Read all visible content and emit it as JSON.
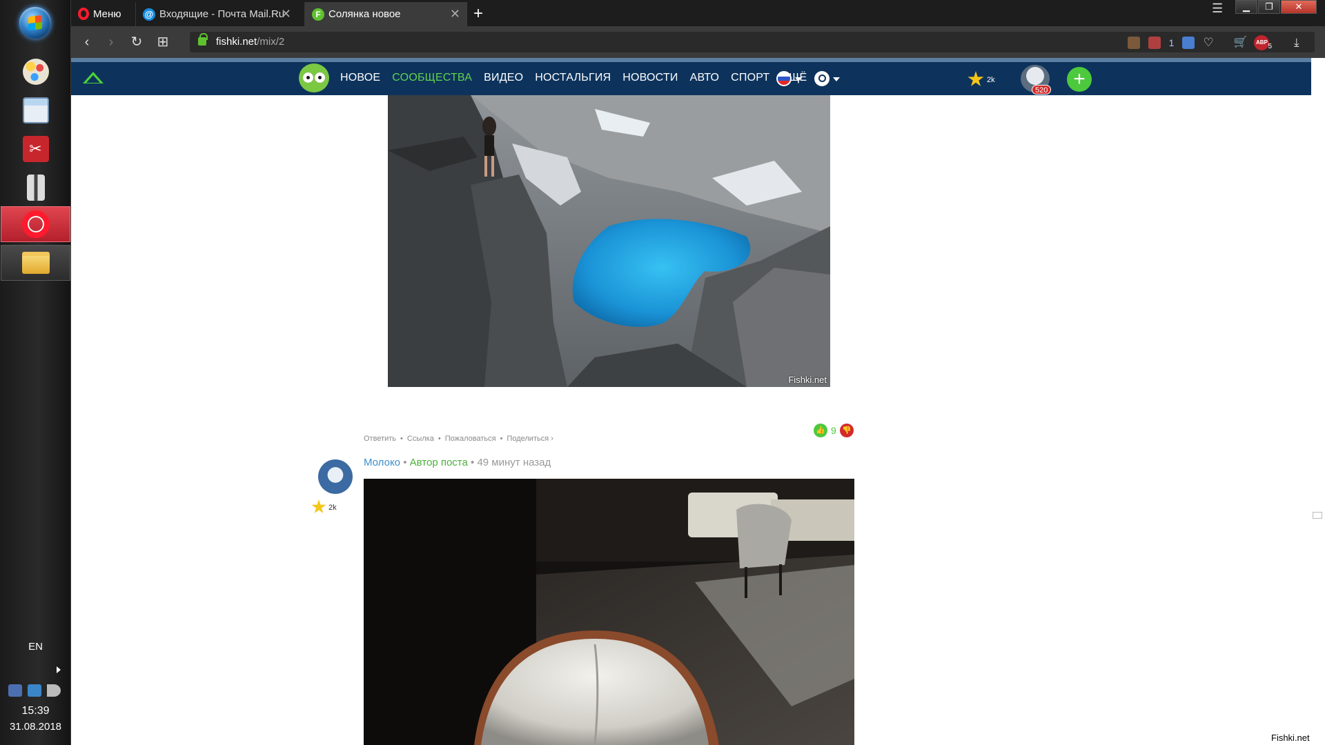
{
  "taskbar": {
    "language": "EN",
    "time": "15:39",
    "date": "31.08.2018",
    "apps": [
      {
        "name": "paint-app",
        "icon": "paint-palette-icon"
      },
      {
        "name": "calculator-app",
        "icon": "calculator-icon"
      },
      {
        "name": "red-tool-app",
        "icon": "scissors-tool-icon"
      },
      {
        "name": "archive-app",
        "icon": "archive-icon"
      },
      {
        "name": "opera-app",
        "icon": "opera-icon"
      },
      {
        "name": "explorer-app",
        "icon": "folder-icon"
      }
    ]
  },
  "browser": {
    "menu_label": "Меню",
    "tabs": [
      {
        "title": "Входящие - Почта Mail.Ru",
        "favicon": "@"
      },
      {
        "title": "Солянка новое",
        "favicon": "F"
      }
    ],
    "new_tab": "+",
    "address": {
      "host": "fishki.net",
      "path": "/mix/2"
    },
    "extensions": {
      "badge_count": "1",
      "abp_label": "ABP",
      "abp_count": "5"
    }
  },
  "site": {
    "nav": [
      "НОВОЕ",
      "СООБЩЕСТВА",
      "ВИДЕО",
      "НОСТАЛЬГИЯ",
      "НОВОСТИ",
      "АВТО",
      "СПОРТ",
      "ЕЩЁ"
    ],
    "nav_active_index": 1,
    "rating": "2k",
    "notifications": "520"
  },
  "post": {
    "watermark": "Fishki.net",
    "actions": [
      "Ответить",
      "•",
      "Ссылка",
      "•",
      "Пожаловаться",
      "•",
      "Поделиться ›"
    ],
    "votes": "9"
  },
  "comment": {
    "author": "Молоко",
    "separator": "•",
    "role": "Автор поста",
    "time": "49 минут назад",
    "rating": "2k"
  },
  "page_watermark": "Fishki.net",
  "colors": {
    "nav_bg": "#0d335c",
    "accent_green": "#62d24f",
    "opera_red": "#ff1b2d"
  }
}
